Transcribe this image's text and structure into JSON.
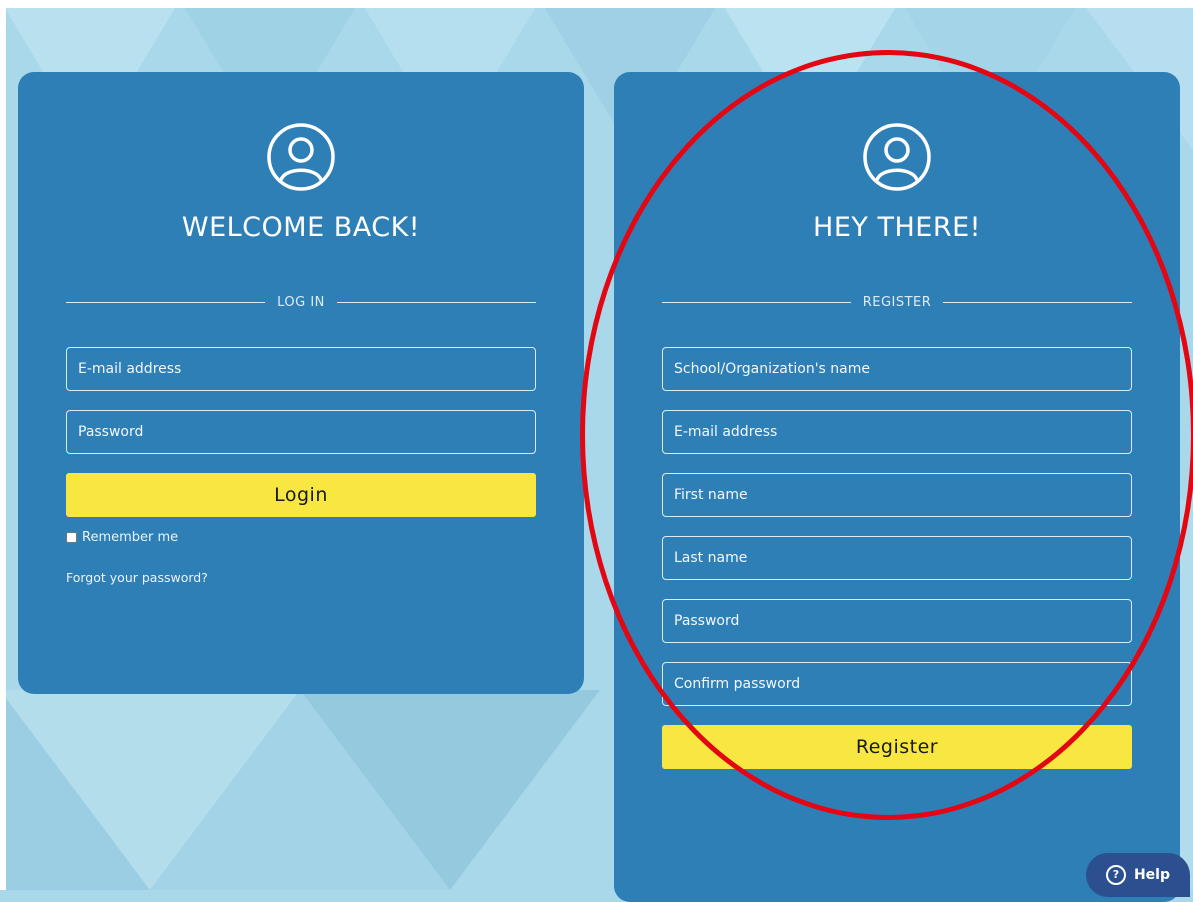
{
  "login": {
    "title": "WELCOME BACK!",
    "section_label": "LOG IN",
    "email_placeholder": "E-mail address",
    "password_placeholder": "Password",
    "submit_label": "Login",
    "remember_label": "Remember me",
    "forgot_link": "Forgot your password?"
  },
  "register": {
    "title": "HEY THERE!",
    "section_label": "REGISTER",
    "school_placeholder": "School/Organization's name",
    "email_placeholder": "E-mail address",
    "first_name_placeholder": "First name",
    "last_name_placeholder": "Last name",
    "password_placeholder": "Password",
    "confirm_password_placeholder": "Confirm password",
    "submit_label": "Register"
  },
  "help": {
    "label": "Help",
    "icon": "question-circle-icon"
  },
  "icons": {
    "avatar": "user-circle-icon"
  },
  "colors": {
    "panel": "#2f7fb7",
    "button": "#f7e740",
    "background": "#a9d8ea",
    "highlight_ring": "#e30613",
    "help_button": "#2c4f8f"
  }
}
